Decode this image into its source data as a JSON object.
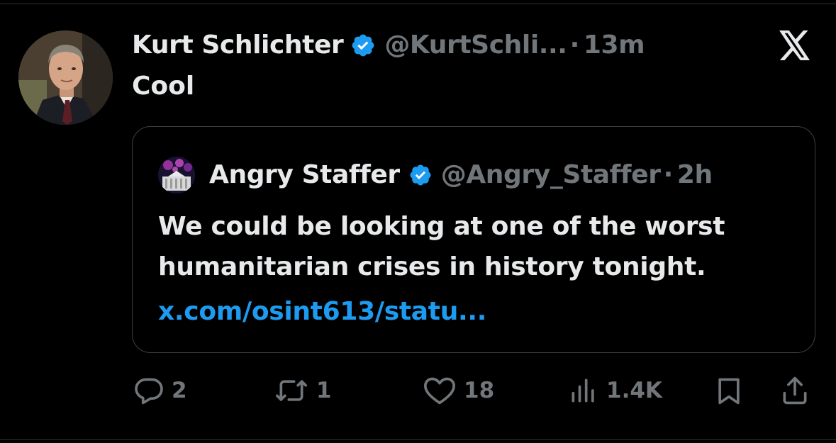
{
  "tweet": {
    "author_name": "Kurt Schlichter",
    "author_handle": "@KurtSchli...",
    "separator": "·",
    "time": "13m",
    "text": "Cool",
    "platform_icon": "x-logo-icon",
    "verified_icon": "verified-badge-icon"
  },
  "quoted_tweet": {
    "author_name": "Angry Staffer",
    "author_handle": "@Angry_Staffer",
    "separator": "·",
    "time": "2h",
    "text_line_1": "We could be looking at one of the worst",
    "text_line_2": "humanitarian crises in history tonight.",
    "link": "x.com/osint613/statu..."
  },
  "actions": {
    "reply": {
      "icon": "reply-icon",
      "count": "2"
    },
    "repost": {
      "icon": "repost-icon",
      "count": "1"
    },
    "like": {
      "icon": "heart-icon",
      "count": "18"
    },
    "views": {
      "icon": "views-icon",
      "count": "1.4K"
    },
    "bookmark": {
      "icon": "bookmark-icon"
    },
    "share": {
      "icon": "share-icon"
    }
  },
  "colors": {
    "background": "#000000",
    "text_primary": "#e7e9ea",
    "text_secondary": "#71767b",
    "link": "#1d9bf0",
    "verified": "#1d9bf0",
    "border": "#3a3f44"
  }
}
